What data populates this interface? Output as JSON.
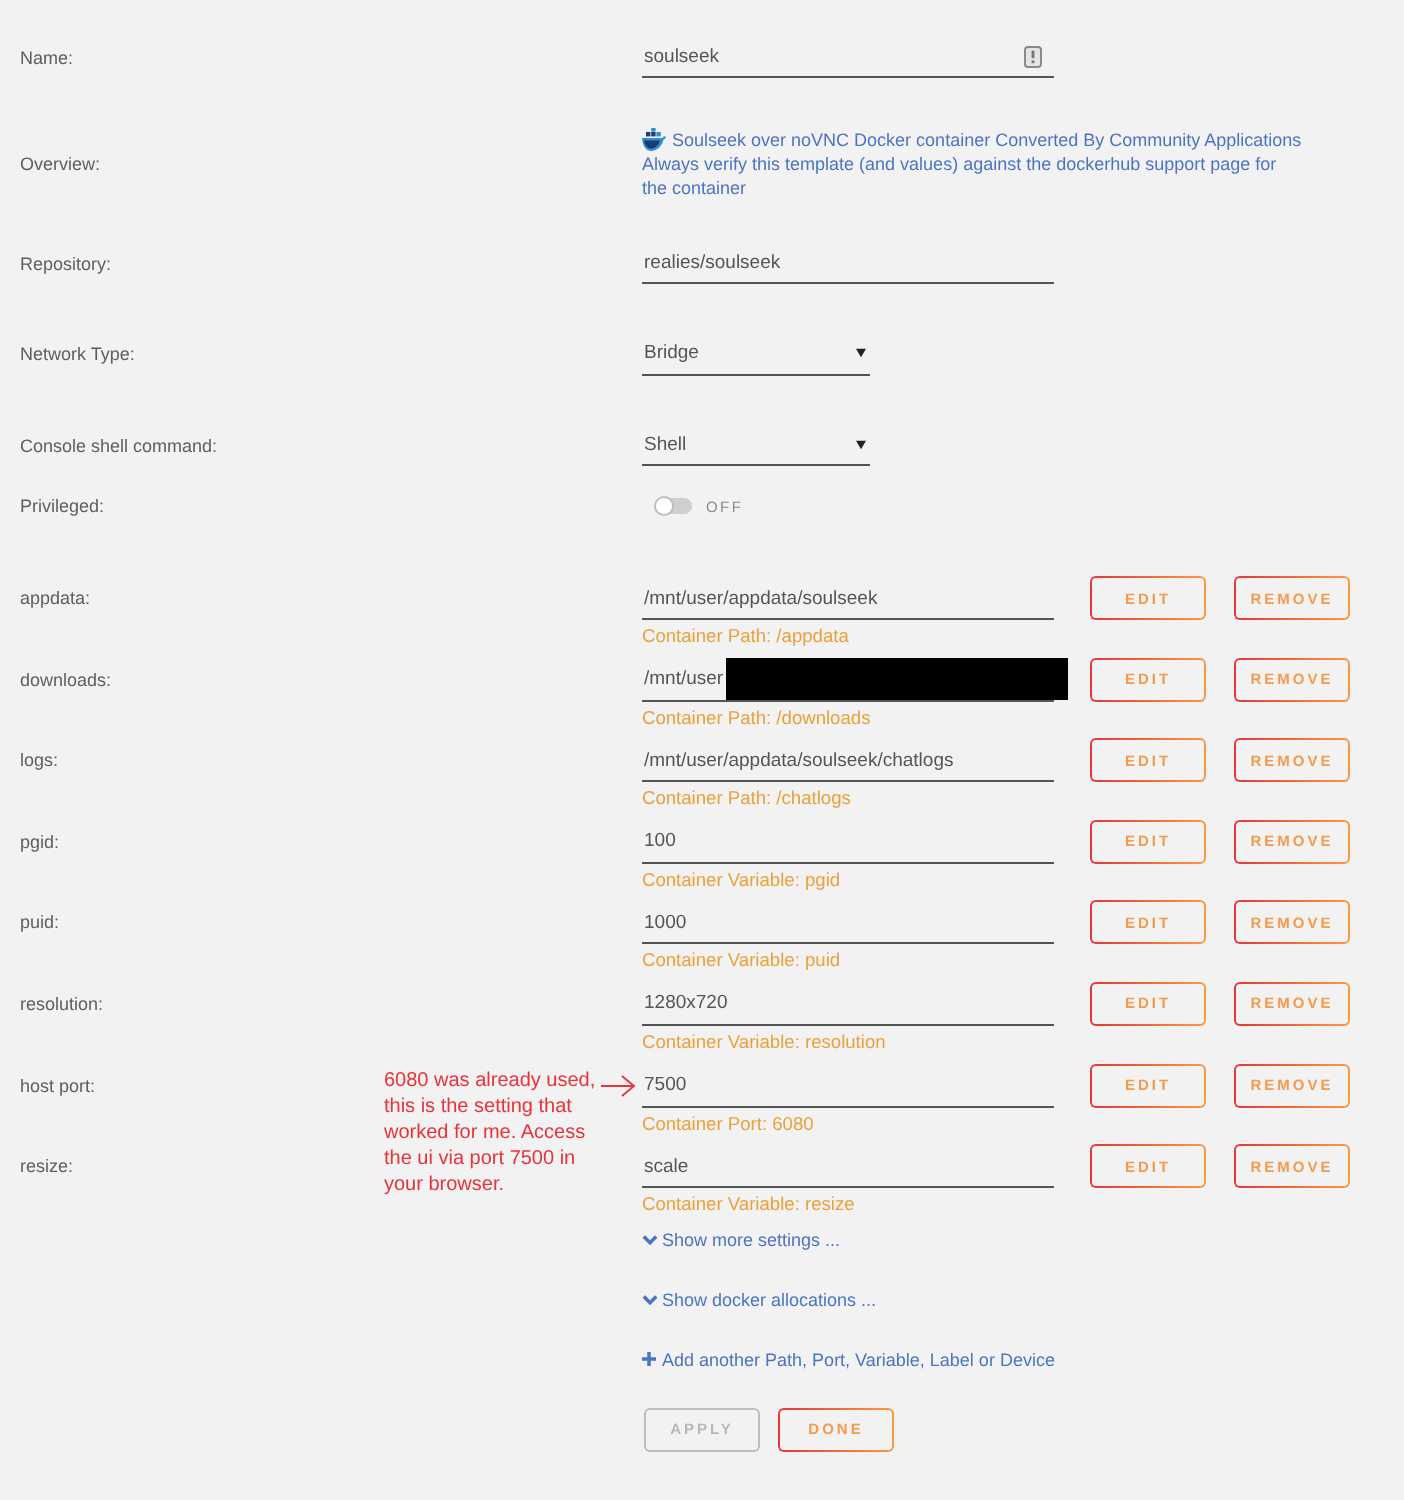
{
  "settings": [
    {
      "kind": "name",
      "label": "Name:",
      "value": "soulseek"
    },
    {
      "kind": "overview",
      "label": "Overview:",
      "description": "Soulseek over noVNC Docker container Converted By Community Applications",
      "notice": "Always verify this template (and values) against the dockerhub support page for the container"
    },
    {
      "kind": "text",
      "label": "Repository:",
      "value": "realies/soulseek"
    },
    {
      "kind": "select",
      "label": "Network Type:",
      "value": "Bridge"
    },
    {
      "kind": "select",
      "label": "Console shell command:",
      "value": "Shell"
    },
    {
      "kind": "toggle",
      "label": "Privileged:",
      "on": false,
      "state_text": "OFF"
    }
  ],
  "configs": [
    {
      "label": "appdata:",
      "value": "/mnt/user/appdata/soulseek",
      "redacted": false,
      "hint": "Container Path: /appdata",
      "actions": [
        "EDIT",
        "REMOVE"
      ]
    },
    {
      "label": "downloads:",
      "value": "/mnt/user",
      "redacted": true,
      "hint": "Container Path: /downloads",
      "actions": [
        "EDIT",
        "REMOVE"
      ]
    },
    {
      "label": "logs:",
      "value": "/mnt/user/appdata/soulseek/chatlogs",
      "redacted": false,
      "hint": "Container Path: /chatlogs",
      "actions": [
        "EDIT",
        "REMOVE"
      ]
    },
    {
      "label": "pgid:",
      "value": "100",
      "redacted": false,
      "hint": "Container Variable: pgid",
      "actions": [
        "EDIT",
        "REMOVE"
      ]
    },
    {
      "label": "puid:",
      "value": "1000",
      "redacted": false,
      "hint": "Container Variable: puid",
      "actions": [
        "EDIT",
        "REMOVE"
      ]
    },
    {
      "label": "resolution:",
      "value": "1280x720",
      "redacted": false,
      "hint": "Container Variable: resolution",
      "actions": [
        "EDIT",
        "REMOVE"
      ]
    },
    {
      "label": "host port:",
      "value": "7500",
      "redacted": false,
      "hint": "Container Port: 6080",
      "note": "6080 was already used, this is the setting that worked for me. Access the ui via port 7500 in your browser.",
      "actions": [
        "EDIT",
        "REMOVE"
      ]
    },
    {
      "label": "resize:",
      "value": "scale",
      "redacted": false,
      "hint": "Container Variable: resize",
      "actions": [
        "EDIT",
        "REMOVE"
      ]
    }
  ],
  "links": [
    {
      "kind": "expand",
      "text": "Show more settings ..."
    },
    {
      "kind": "expand",
      "text": "Show docker allocations ..."
    },
    {
      "kind": "add",
      "text": "Add another Path, Port, Variable, Label or Device"
    }
  ],
  "footer_buttons": [
    {
      "label": "APPLY",
      "disabled": true
    },
    {
      "label": "DONE",
      "disabled": false
    }
  ]
}
